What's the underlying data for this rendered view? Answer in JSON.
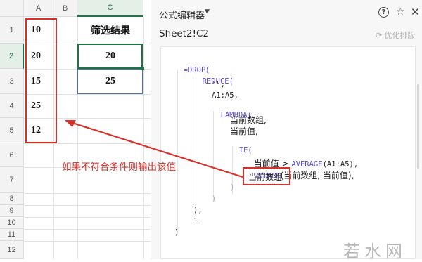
{
  "sheet": {
    "columns": [
      "A",
      "B",
      "C"
    ],
    "rows": [
      "1",
      "2",
      "3",
      "4",
      "5",
      "6",
      "7",
      "8",
      "9",
      "10",
      "11",
      "12"
    ],
    "col_a_values": [
      "10",
      "20",
      "15",
      "25",
      "12"
    ],
    "c1_header": "筛选结果",
    "c2_value": "20",
    "c3_value": "25"
  },
  "annotation": "如果不符合条件则输出该值",
  "panel": {
    "title": "公式编辑器",
    "cell_ref": "Sheet2!C2",
    "optimize_label": "优化排版"
  },
  "formula": {
    "line1": "=DROP(",
    "line2": "REDUCE(",
    "line3": "\"\",",
    "line4": "A1:A5,",
    "line5": "LAMBDA(",
    "line6": "当前数组,",
    "line7": "当前值,",
    "line8": "IF(",
    "line9_a": "当前值 > ",
    "line9_b": "AVERAGE",
    "line9_c": "(A1:A5),",
    "line10_a": "VSTACK",
    "line10_b": "(当前数组, 当前值),",
    "line11": "当前数组",
    "line12": ")",
    "line13": ")",
    "line14": "),",
    "line15": "1",
    "line16": ")"
  },
  "watermark": "若水网",
  "colors": {
    "accent_green": "#217346",
    "annotation_red": "#d9302a",
    "function_purple": "#5a4bd0"
  }
}
